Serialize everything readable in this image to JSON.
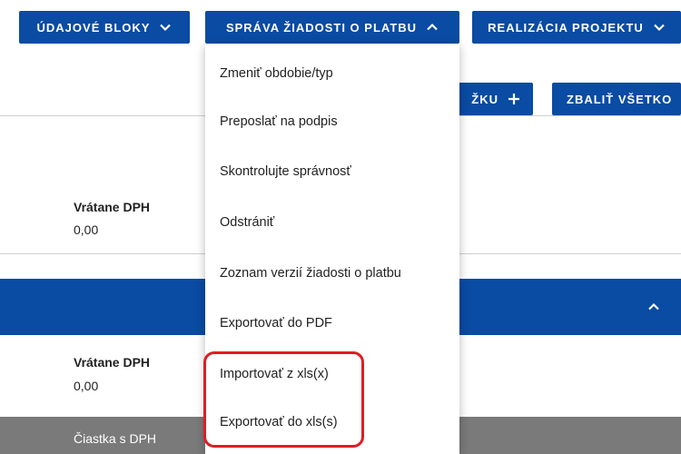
{
  "toolbar": {
    "data_blocks_label": "ÚDAJOVÉ BLOKY",
    "payment_request_label": "SPRÁVA ŽIADOSTI O PLATBU",
    "project_realization_label": "REALIZÁCIA PROJEKTU",
    "add_item_label": "ŽKU",
    "collapse_all_label": "ZBALIŤ VŠETKO"
  },
  "section1": {
    "label": "Vrátane DPH",
    "value": "0,00"
  },
  "section2": {
    "label": "Vrátane DPH",
    "value": "0,00"
  },
  "table_header": {
    "label": "Čiastka s DPH"
  },
  "dropdown": {
    "items": [
      "Zmeniť obdobie/typ",
      "Preposlať na podpis",
      "Skontrolujte správnosť",
      "Odstrániť",
      "Zoznam verzií žiadosti o platbu",
      "Exportovať do PDF",
      "Importovať z xls(x)",
      "Exportovať do xls(s)"
    ]
  },
  "colors": {
    "primary": "#0a4ba3",
    "highlight": "#e31b23",
    "gray_band": "#7a7a7a"
  }
}
